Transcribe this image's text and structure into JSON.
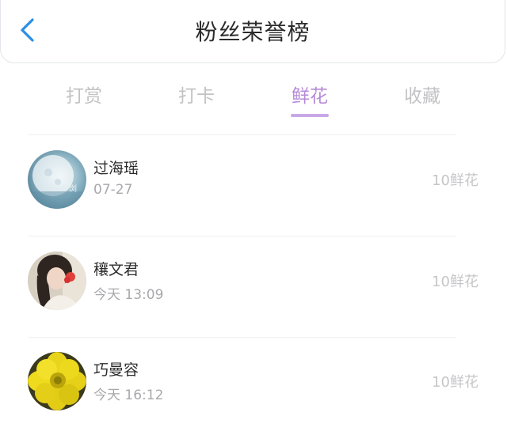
{
  "header": {
    "title": "粉丝荣誉榜",
    "back_icon": "chevron-left-icon",
    "accent_color": "#2a8ee6"
  },
  "tabs": [
    {
      "label": "打赏",
      "active": false
    },
    {
      "label": "打卡",
      "active": false
    },
    {
      "label": "鲜花",
      "active": true
    },
    {
      "label": "收藏",
      "active": false
    }
  ],
  "active_tab_color": "#b78ad8",
  "fans": [
    {
      "name": "过海瑶",
      "time": "07-27",
      "count": "10鲜花",
      "avatar": "moon-avatar"
    },
    {
      "name": "穰文君",
      "time": "今天 13:09",
      "count": "10鲜花",
      "avatar": "girl-avatar"
    },
    {
      "name": "巧曼容",
      "time": "今天 16:12",
      "count": "10鲜花",
      "avatar": "flower-avatar"
    }
  ]
}
